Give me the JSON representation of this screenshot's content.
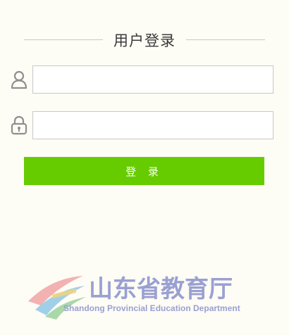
{
  "login": {
    "title": "用户登录",
    "username": {
      "value": "",
      "placeholder": ""
    },
    "password": {
      "value": "",
      "placeholder": ""
    },
    "button_label": "登 录"
  },
  "logo": {
    "name_cn": "山东省教育厅",
    "name_en": "Shandong Provincial Education Department"
  },
  "colors": {
    "background": "#fdfcf5",
    "button": "#66cc00",
    "logo_text": "#9aa0d2"
  },
  "icons": [
    "user-icon",
    "lock-icon"
  ]
}
